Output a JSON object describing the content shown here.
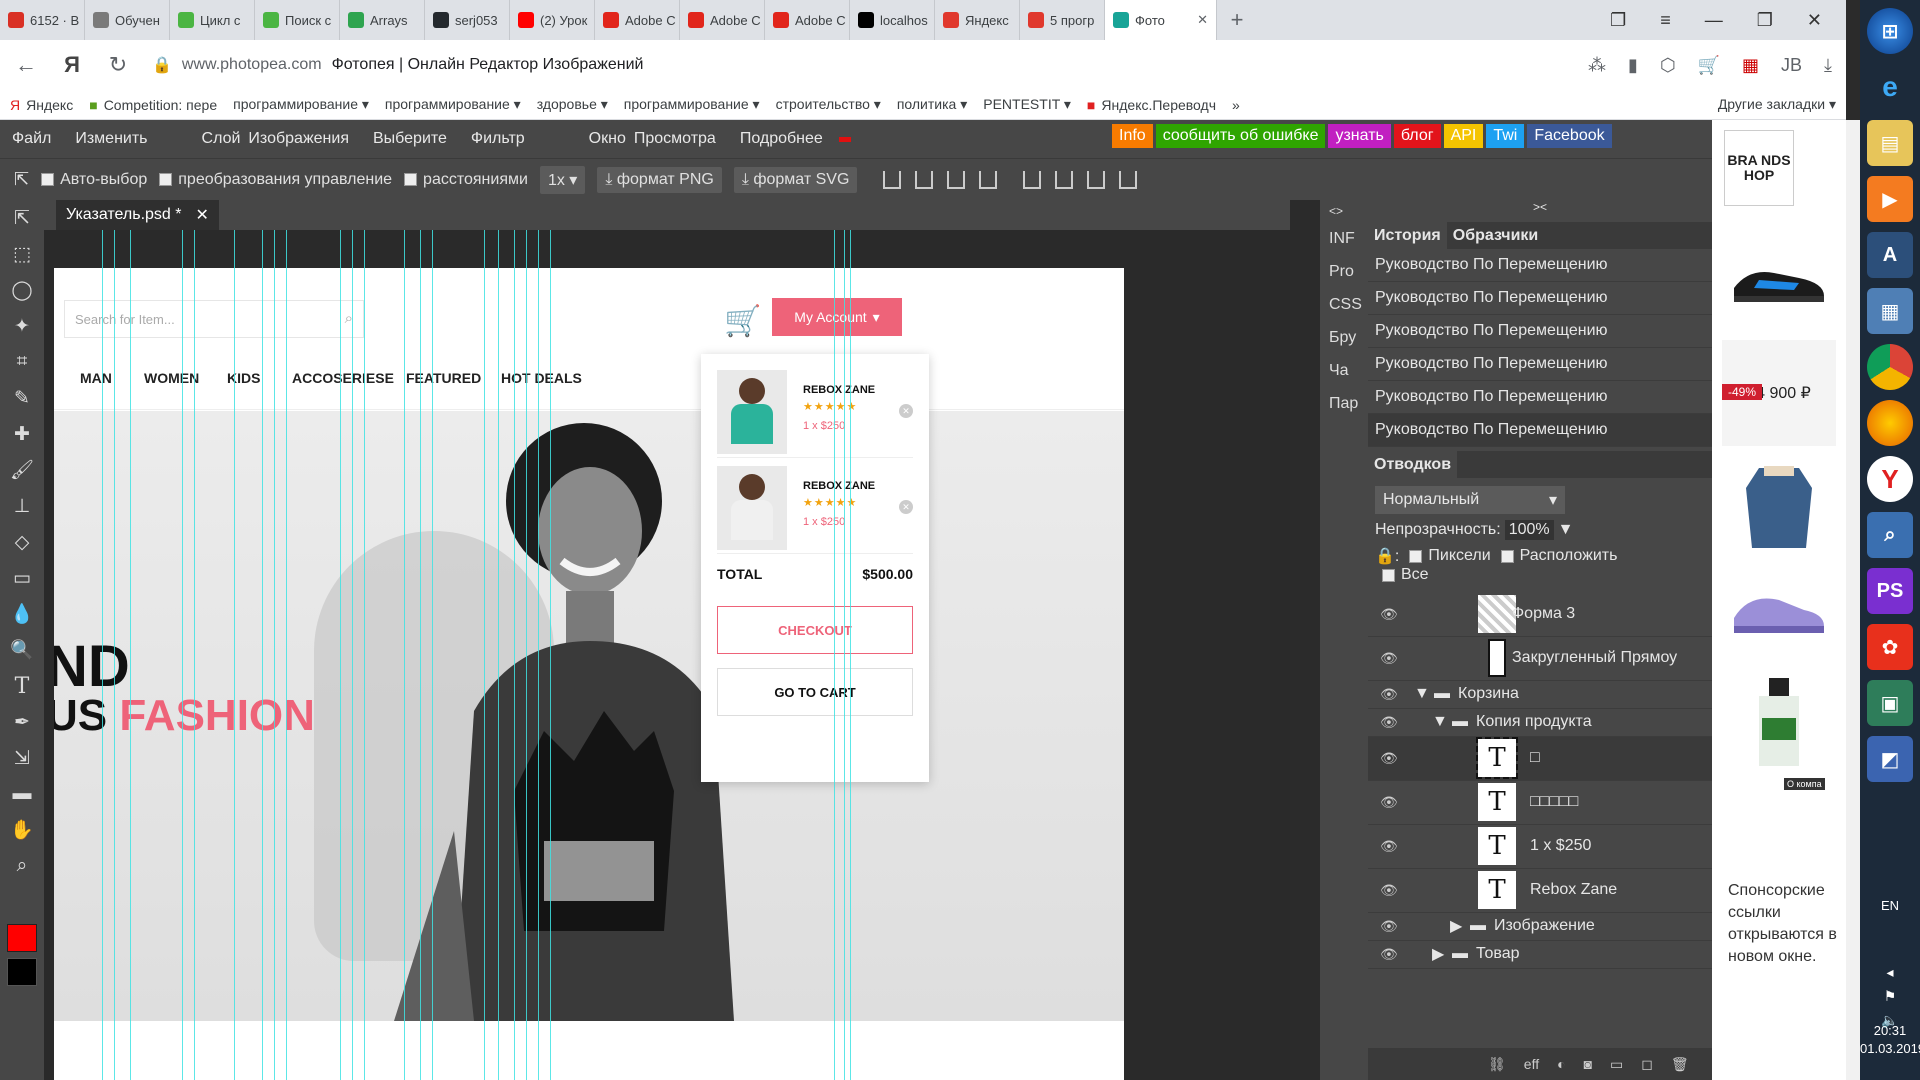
{
  "browser": {
    "tabs": [
      {
        "label": "6152 · В",
        "icon": "mail-icon",
        "color": "#d93025",
        "active": false
      },
      {
        "label": "Обучен",
        "icon": "brain-icon",
        "color": "#7a7a7a",
        "active": false
      },
      {
        "label": "Цикл с",
        "icon": "check-icon",
        "color": "#4bb543",
        "active": false
      },
      {
        "label": "Поиск с",
        "icon": "check-icon",
        "color": "#4bb543",
        "active": false
      },
      {
        "label": "Arrays",
        "icon": "h-icon",
        "color": "#2ea44f",
        "active": false
      },
      {
        "label": "serj053",
        "icon": "github-icon",
        "color": "#24292e",
        "active": false
      },
      {
        "label": "(2) Урок",
        "icon": "youtube-icon",
        "color": "#ff0000",
        "active": false
      },
      {
        "label": "Adobe С",
        "icon": "adobe-icon",
        "color": "#e1251b",
        "active": false
      },
      {
        "label": "Adobe С",
        "icon": "adobe-icon",
        "color": "#e1251b",
        "active": false
      },
      {
        "label": "Adobe С",
        "icon": "adobe-icon",
        "color": "#e1251b",
        "active": false
      },
      {
        "label": "localhos",
        "icon": "phpstorm-icon",
        "color": "#000000",
        "active": false
      },
      {
        "label": "Яндекс",
        "icon": "yandex-icon",
        "color": "#e0382d",
        "active": false
      },
      {
        "label": "5 прогр",
        "icon": "habr-icon",
        "color": "#e0382d",
        "active": false
      },
      {
        "label": "Фото",
        "icon": "photopea-icon",
        "color": "#18a497",
        "active": true
      }
    ],
    "new_tab": "+",
    "url_host": "www.photopea.com",
    "url_title": "Фотопея | Онлайн Редактор Изображений",
    "bookmarks": [
      "Яндекс",
      "Competition: пере",
      "программирование ▾",
      "программирование ▾",
      "здоровье ▾",
      "программирование ▾",
      "строительство ▾",
      "политика ▾",
      "PENTESTIT ▾",
      "Яндекс.Переводч"
    ],
    "more_bookmarks": "»",
    "other_bookmarks": "Другие закладки ▾"
  },
  "photopea": {
    "menu": [
      "Файл",
      "Изменить",
      "Слой",
      "Изображения",
      "Выберите",
      "Фильтр",
      "Окно",
      "Просмотра",
      "Подробнее"
    ],
    "links": [
      {
        "label": "Info",
        "color": "#f77b00"
      },
      {
        "label": "сообщить об ошибке",
        "color": "#2fa500"
      },
      {
        "label": "узнать",
        "color": "#c11fc1"
      },
      {
        "label": "блог",
        "color": "#e2141b"
      },
      {
        "label": "API",
        "color": "#f5c400"
      },
      {
        "label": "Twi",
        "color": "#1da1f2"
      },
      {
        "label": "Facebook",
        "color": "#3b5998"
      }
    ],
    "options": {
      "auto_select": "Авто-выбор",
      "transform": "преобразования управление",
      "distances": "расстояниями",
      "scale": "1x",
      "png": "формат PNG",
      "svg": "формат SVG"
    },
    "doc_tab": "Указатель.psd *",
    "side_panel": [
      "INF",
      "Pro",
      "CSS",
      "Бру",
      "Ча",
      "Пар"
    ],
    "history": {
      "tabs": [
        "История",
        "Образчики"
      ],
      "items": [
        "Руководство По Перемещению",
        "Руководство По Перемещению",
        "Руководство По Перемещению",
        "Руководство По Перемещению",
        "Руководство По Перемещению",
        "Руководство По Перемещению"
      ]
    },
    "layers": {
      "tab": "Отводков",
      "blend": "Нормальный",
      "opacity_label": "Непрозрачность:",
      "opacity": "100%",
      "lock_pixels": "Пиксели",
      "lock_position": "Расположить",
      "lock_all": "Все",
      "items": [
        {
          "name": "Форма 3",
          "type": "shape"
        },
        {
          "name": "Закругленный Прямоу",
          "type": "shape"
        },
        {
          "name": "Корзина",
          "type": "group"
        },
        {
          "name": "Копия продукта",
          "type": "group"
        },
        {
          "name": "□",
          "type": "text"
        },
        {
          "name": "□□□□□",
          "type": "text"
        },
        {
          "name": "1 x $250",
          "type": "text"
        },
        {
          "name": "Rebox Zane",
          "type": "text"
        },
        {
          "name": "Изображение",
          "type": "group"
        },
        {
          "name": "Товар",
          "type": "group"
        }
      ],
      "footer": "eff"
    },
    "canvas": {
      "search_placeholder": "Search for Item...",
      "my_account": "My Account",
      "nav": [
        "MAN",
        "WOMEN",
        "KIDS",
        "ACCOSERIESE",
        "FEATURED",
        "HOT DEALS"
      ],
      "hero_line1": "ND",
      "hero_line2_a": "US",
      "hero_line2_b": "FASHION",
      "cart_items": [
        {
          "name": "REBOX ZANE",
          "stars": "★★★★★",
          "price": "1 x $250",
          "shirt": "#2bb39b"
        },
        {
          "name": "REBOX ZANE",
          "stars": "★★★★★",
          "price": "1 x $250",
          "shirt": "#f0f0f0"
        }
      ],
      "total_label": "TOTAL",
      "total_value": "$500.00",
      "checkout": "CHECKOUT",
      "go_to_cart": "GO TO CART"
    }
  },
  "ads": {
    "brand": "BRA NDS HOP",
    "price": "24 900 ₽",
    "discount": "-49%",
    "badge": "О компа",
    "sponsor_text": "Спонсорские ссылки открываются в новом окне."
  },
  "taskbar": {
    "lang": "EN",
    "time": "20:31",
    "date": "01.03.2019"
  }
}
